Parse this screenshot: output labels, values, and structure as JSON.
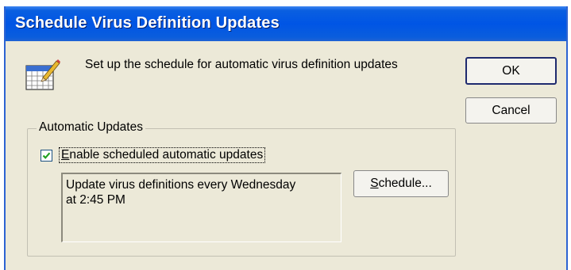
{
  "dialog": {
    "title": "Schedule Virus Definition Updates",
    "description": "Set up the schedule for automatic virus definition updates",
    "icon": "calendar-edit-icon"
  },
  "buttons": {
    "ok_label": "OK",
    "cancel_label": "Cancel",
    "schedule_label_underlined": "S",
    "schedule_label_rest": "chedule..."
  },
  "automatic_updates": {
    "group_label": "Automatic Updates",
    "enable_checkbox_underlined": "E",
    "enable_checkbox_rest": "nable scheduled automatic updates",
    "enable_checked": true,
    "schedule_text_line1": "Update virus definitions every Wednesday",
    "schedule_text_line2": "at 2:45 PM"
  },
  "colors": {
    "title_bar": "#0055e5",
    "dialog_background": "#ece9d8",
    "title_text": "#ffffff"
  }
}
